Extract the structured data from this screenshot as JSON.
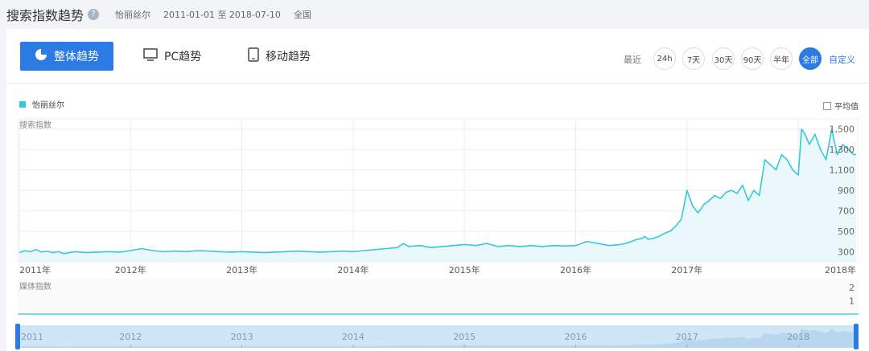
{
  "header": {
    "title": "搜索指数趋势",
    "keyword": "怡丽丝尔",
    "date_range": "2011-01-01 至 2018-07-10",
    "region": "全国"
  },
  "tabs": [
    {
      "label": "整体趋势",
      "icon": "pie-chart-icon",
      "active": true
    },
    {
      "label": "PC趋势",
      "icon": "monitor-icon",
      "active": false
    },
    {
      "label": "移动趋势",
      "icon": "tablet-icon",
      "active": false
    }
  ],
  "range": {
    "label": "最近",
    "options": [
      "24h",
      "7天",
      "30天",
      "90天",
      "半年",
      "全部"
    ],
    "selected": "全部",
    "custom": "自定义"
  },
  "colors": {
    "accent": "#2c7be5",
    "series": "#35c8dc",
    "fill": "#eaf8fb"
  },
  "chart_data": [
    {
      "type": "line",
      "ylabel": "搜索指数",
      "legend": "怡丽丝尔",
      "legend_position": "top-left",
      "average_toggle": "平均值",
      "x_ticks": [
        "2011年",
        "2012年",
        "2013年",
        "2014年",
        "2015年",
        "2016年",
        "2017年",
        "2018年"
      ],
      "y_ticks": [
        300,
        500,
        700,
        900,
        "1,100",
        "1,300",
        "1,500"
      ],
      "xlim": [
        2011.0,
        2018.52
      ],
      "ylim": [
        200,
        1600
      ],
      "series": [
        {
          "name": "怡丽丝尔",
          "x": [
            2011.0,
            2011.05,
            2011.1,
            2011.15,
            2011.2,
            2011.25,
            2011.3,
            2011.35,
            2011.4,
            2011.5,
            2011.6,
            2011.7,
            2011.8,
            2011.9,
            2012.0,
            2012.1,
            2012.2,
            2012.3,
            2012.4,
            2012.5,
            2012.6,
            2012.7,
            2012.8,
            2012.9,
            2013.0,
            2013.1,
            2013.2,
            2013.3,
            2013.4,
            2013.5,
            2013.6,
            2013.7,
            2013.8,
            2013.9,
            2014.0,
            2014.1,
            2014.2,
            2014.3,
            2014.4,
            2014.45,
            2014.5,
            2014.6,
            2014.7,
            2014.8,
            2014.9,
            2015.0,
            2015.1,
            2015.2,
            2015.3,
            2015.4,
            2015.5,
            2015.6,
            2015.7,
            2015.8,
            2015.9,
            2016.0,
            2016.1,
            2016.2,
            2016.3,
            2016.4,
            2016.45,
            2016.5,
            2016.55,
            2016.6,
            2016.62,
            2016.65,
            2016.7,
            2016.75,
            2016.8,
            2016.85,
            2016.9,
            2016.95,
            2017.0,
            2017.05,
            2017.1,
            2017.15,
            2017.2,
            2017.25,
            2017.3,
            2017.35,
            2017.4,
            2017.45,
            2017.5,
            2017.55,
            2017.6,
            2017.65,
            2017.7,
            2017.75,
            2017.8,
            2017.85,
            2017.9,
            2017.95,
            2018.0,
            2018.03,
            2018.06,
            2018.1,
            2018.15,
            2018.2,
            2018.25,
            2018.3,
            2018.35,
            2018.4,
            2018.45,
            2018.5,
            2018.52
          ],
          "values": [
            290,
            310,
            300,
            320,
            295,
            305,
            290,
            300,
            280,
            300,
            290,
            295,
            300,
            295,
            310,
            330,
            310,
            300,
            305,
            300,
            310,
            305,
            300,
            295,
            300,
            295,
            290,
            295,
            300,
            305,
            300,
            295,
            300,
            305,
            300,
            310,
            320,
            330,
            340,
            380,
            350,
            360,
            340,
            350,
            360,
            370,
            360,
            380,
            350,
            360,
            350,
            360,
            350,
            360,
            355,
            360,
            400,
            380,
            360,
            370,
            380,
            400,
            420,
            430,
            450,
            420,
            430,
            450,
            480,
            500,
            550,
            620,
            900,
            750,
            680,
            760,
            800,
            850,
            820,
            880,
            900,
            870,
            950,
            800,
            900,
            850,
            1200,
            1150,
            1100,
            1250,
            1200,
            1100,
            1050,
            1500,
            1450,
            1350,
            1450,
            1300,
            1200,
            1500,
            1250,
            1350,
            1300,
            1250,
            1250
          ]
        }
      ]
    },
    {
      "type": "line",
      "ylabel": "媒体指数",
      "y_ticks": [
        1,
        2
      ],
      "ylim": [
        0,
        2
      ]
    },
    {
      "type": "area",
      "x_ticks": [
        "2011",
        "2012",
        "2013",
        "2014",
        "2015",
        "2016",
        "2017",
        "2018"
      ]
    }
  ]
}
